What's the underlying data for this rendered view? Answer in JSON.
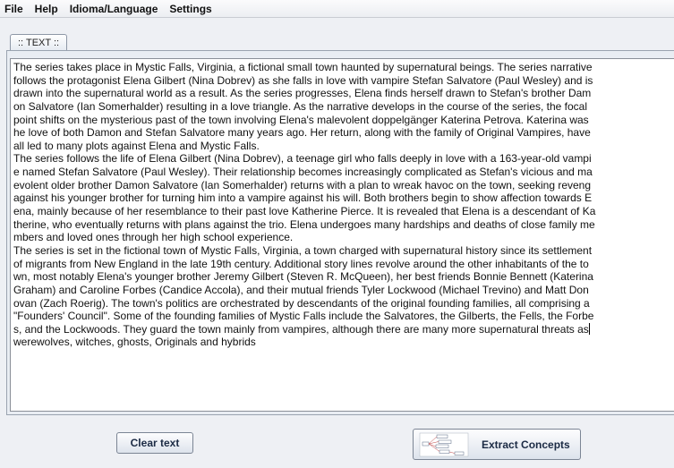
{
  "menu": [
    "File",
    "Help",
    "Idioma/Language",
    "Settings"
  ],
  "tab": {
    "label": ":: TEXT ::"
  },
  "text_lines": [
    "The series takes place in Mystic Falls, Virginia, a fictional small town haunted by supernatural beings. The series narrative",
    "follows the protagonist Elena Gilbert (Nina Dobrev) as she falls in love with vampire Stefan Salvatore (Paul Wesley) and is",
    "drawn into the supernatural world as a result. As the series progresses, Elena finds herself drawn to Stefan's brother Dam",
    "on Salvatore (Ian Somerhalder) resulting in a love triangle. As the narrative develops in the course of the series, the focal",
    "point shifts on the mysterious past of the town involving Elena's malevolent doppelgänger Katerina Petrova. Katerina was",
    "he love of both Damon and Stefan Salvatore many years ago. Her return, along with the family of Original Vampires, have",
    "all led to many plots against Elena and Mystic Falls.",
    "The series follows the life of Elena Gilbert (Nina Dobrev), a teenage girl who falls deeply in love with a 163-year-old vampi",
    "e named Stefan Salvatore (Paul Wesley). Their relationship becomes increasingly complicated as Stefan's vicious and ma",
    "evolent older brother Damon Salvatore (Ian Somerhalder) returns with a plan to wreak havoc on the town, seeking reveng",
    " against his younger brother for turning him into a vampire against his will. Both brothers begin to show affection towards E",
    "ena, mainly because of her resemblance to their past love Katherine Pierce. It is revealed that Elena is a descendant of Ka",
    "therine, who eventually returns with plans against the trio. Elena undergoes many hardships and deaths of close family me",
    "mbers and loved ones through her high school experience.",
    "The series is set in the fictional town of Mystic Falls, Virginia, a town charged with supernatural history since its settlement",
    "of migrants from New England in the late 19th century. Additional story lines revolve around the other inhabitants of the to",
    "wn, most notably Elena's younger brother Jeremy Gilbert (Steven R. McQueen), her best friends Bonnie Bennett (Katerina",
    "Graham) and Caroline Forbes (Candice Accola), and their mutual friends Tyler Lockwood (Michael Trevino) and Matt Don",
    "ovan (Zach Roerig). The town's politics are orchestrated by descendants of the original founding families, all comprising a",
    "\"Founders' Council\". Some of the founding families of Mystic Falls include the Salvatores, the Gilberts, the Fells, the Forbe",
    "s, and the Lockwoods. They guard the town mainly from vampires, although there are many more supernatural threats as",
    "werewolves, witches, ghosts, Originals and hybrids"
  ],
  "buttons": {
    "clear": "Clear text",
    "extract": "Extract Concepts"
  },
  "icons": {
    "extract": "concept-map-icon"
  },
  "colors": {
    "background": "#eef0f4",
    "button_text": "#1b2a44",
    "text_area": "#ffffff"
  }
}
